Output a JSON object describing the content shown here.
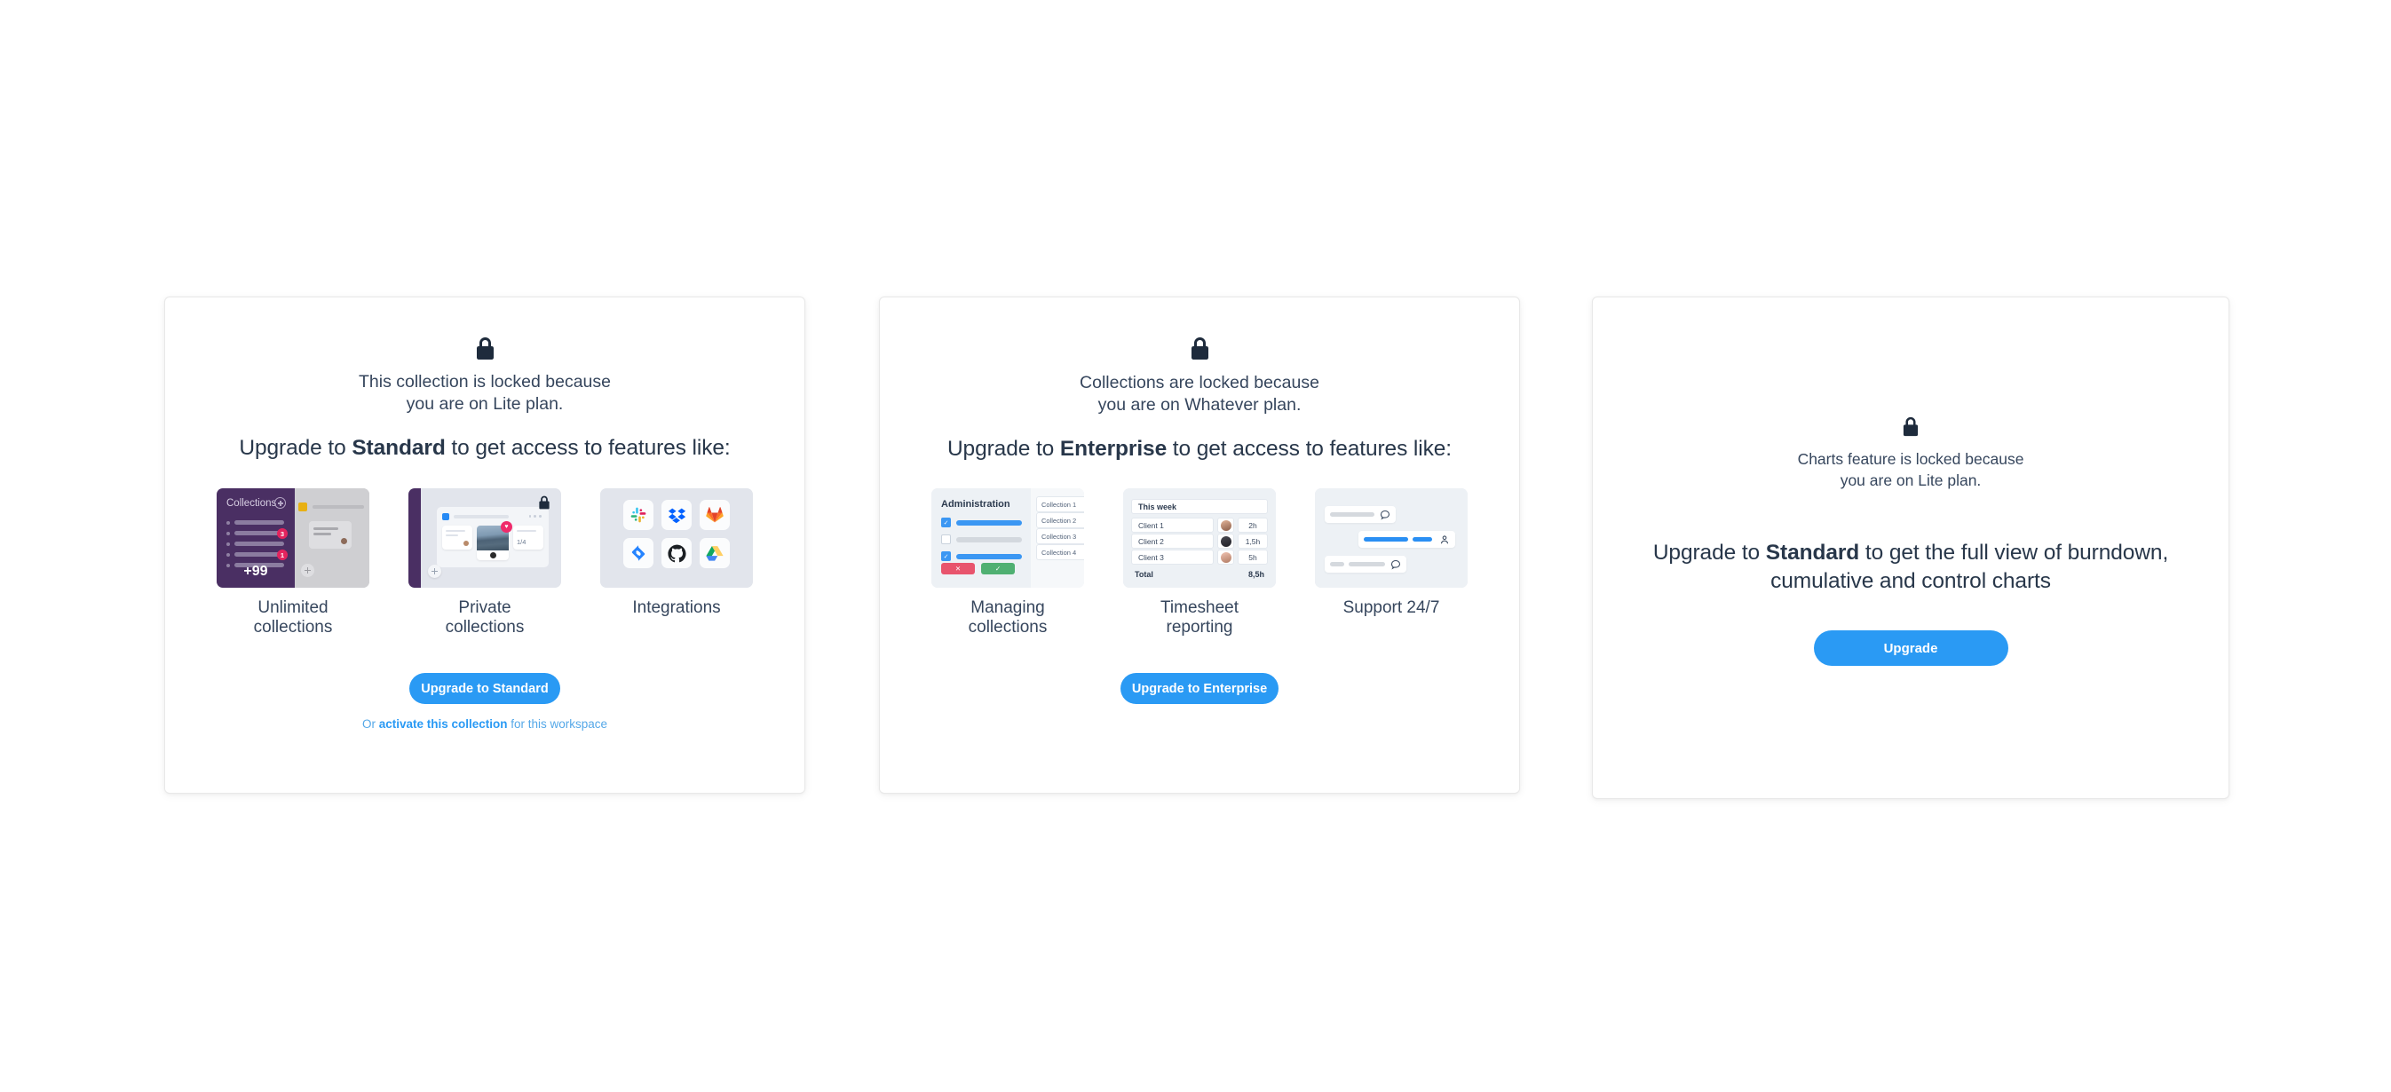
{
  "page": {
    "background": "#ffffff",
    "accent_blue": "#2a9af4",
    "text_dark": "#36465d",
    "purple": "#4a2f63"
  },
  "cards": [
    {
      "id": "collection-locked-standard",
      "lock_icon": "lock-icon",
      "locked_message": "This collection is locked because\nyou are on Lite plan.",
      "upgrade_prefix": "Upgrade to ",
      "upgrade_plan": "Standard",
      "upgrade_suffix": " to get access to features like:",
      "features": [
        {
          "key": "unlimited-collections",
          "label": "Unlimited\ncollections"
        },
        {
          "key": "private-collections",
          "label": "Private\ncollections"
        },
        {
          "key": "integrations",
          "label": "Integrations"
        }
      ],
      "button_label": "Upgrade to Standard",
      "footer_link": {
        "prefix": "Or ",
        "bold": "activate this collection",
        "suffix": " for this workspace"
      }
    },
    {
      "id": "collections-locked-enterprise",
      "lock_icon": "lock-icon",
      "locked_message": "Collections are locked because\nyou are on Whatever plan.",
      "upgrade_prefix": "Upgrade to ",
      "upgrade_plan": "Enterprise",
      "upgrade_suffix": " to get access to features like:",
      "features": [
        {
          "key": "managing-collections",
          "label": "Managing\ncollections"
        },
        {
          "key": "timesheet-reporting",
          "label": "Timesheet\nreporting"
        },
        {
          "key": "support-24-7",
          "label": "Support 24/7"
        }
      ],
      "button_label": "Upgrade to Enterprise"
    },
    {
      "id": "charts-locked-standard",
      "lock_icon": "lock-icon",
      "locked_message": "Charts feature is locked because\nyou are on Lite plan.",
      "upgrade_prefix": "Upgrade to ",
      "upgrade_plan": "Standard",
      "upgrade_suffix": " to get the full view of burndown,\ncumulative and control charts",
      "button_label": "Upgrade"
    }
  ],
  "thumbnails": {
    "unlimited_collections": {
      "sidebar_title": "Collections",
      "add_icon": "plus-circle-icon",
      "badges": [
        "3",
        "1"
      ],
      "more_count": "+99",
      "fab_icon": "plus-icon"
    },
    "private_collections": {
      "lock_icon": "lock-icon",
      "fraction": "1/4",
      "reaction_icon": "heart-icon",
      "fab_icon": "plus-icon"
    },
    "integrations": {
      "apps": [
        "slack-icon",
        "dropbox-icon",
        "gitlab-icon",
        "jira-icon",
        "github-icon",
        "google-drive-icon"
      ]
    },
    "managing_collections": {
      "title": "Administration",
      "checkboxes": [
        true,
        false,
        true
      ],
      "reject_icon": "cross-icon",
      "accept_icon": "check-icon",
      "collections": [
        "Collection 1",
        "Collection 2",
        "Collection 3",
        "Collection 4"
      ]
    },
    "timesheet_reporting": {
      "period": "This week",
      "columns": [
        "Client",
        "Avatar",
        "Hours"
      ],
      "rows": [
        {
          "client": "Client 1",
          "hours": "2h"
        },
        {
          "client": "Client 2",
          "hours": "1,5h"
        },
        {
          "client": "Client 3",
          "hours": "5h"
        }
      ],
      "total_label": "Total",
      "total_value": "8,5h"
    },
    "support_24_7": {
      "chat_icon": "chat-bubble-icon",
      "user_icon": "person-icon"
    }
  }
}
